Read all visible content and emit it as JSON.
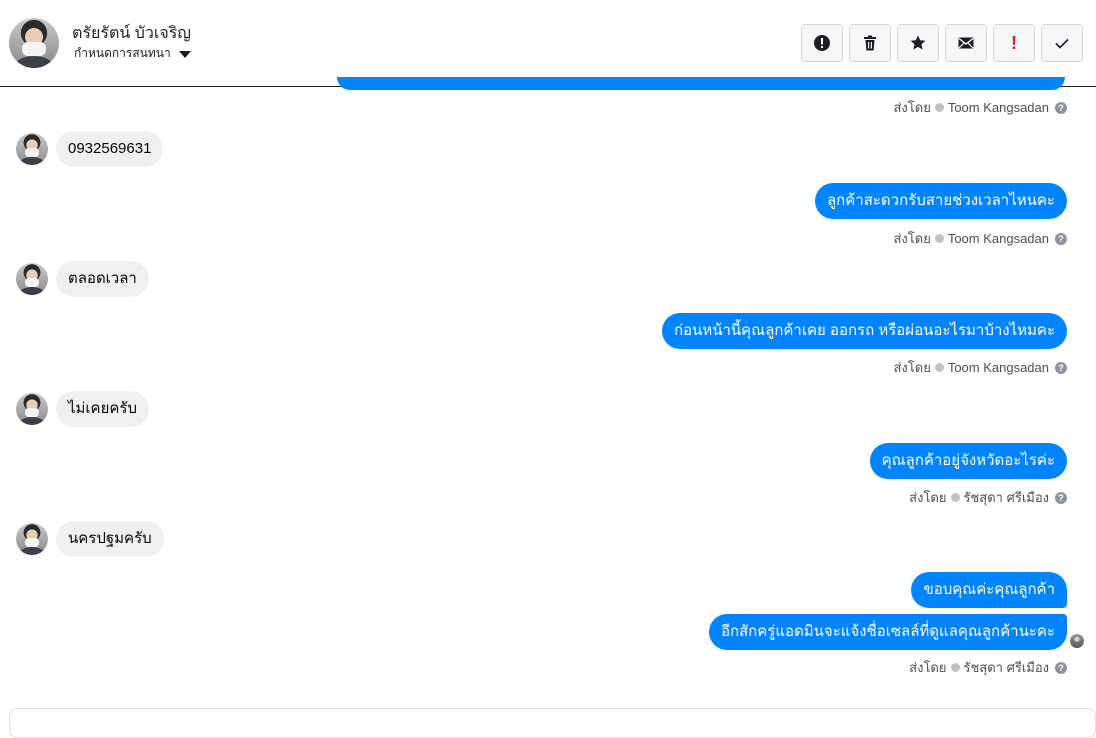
{
  "header": {
    "name": "ตรัยรัตน์ บัวเจริญ",
    "subtitle": "กำหนดการสนทนา",
    "toolbar": [
      {
        "name": "report-spam-button",
        "icon": "exclamation-circle-icon"
      },
      {
        "name": "delete-button",
        "icon": "trash-icon"
      },
      {
        "name": "star-button",
        "icon": "star-icon"
      },
      {
        "name": "mark-unread-button",
        "icon": "envelope-icon"
      },
      {
        "name": "follow-up-button",
        "icon": "exclamation-icon",
        "glyph": "!"
      },
      {
        "name": "mark-done-button",
        "icon": "check-icon"
      }
    ]
  },
  "sender_prefix": "ส่งโดย",
  "messages": {
    "m1": {
      "text": "0932569631"
    },
    "m2": {
      "text": "ลูกค้าสะดวกรับสายช่วงเวลาไหนคะ"
    },
    "m3": {
      "text": "ตลอดเวลา"
    },
    "m4": {
      "text": "ก่อนหน้านี้คุณลูกค้าเคย ออกรถ หรือผ่อนอะไรมาบ้างไหมคะ"
    },
    "m5": {
      "text": "ไม่เคยครับ"
    },
    "m6": {
      "text": "คุณลูกค้าอยู่จังหวัดอะไรค่ะ"
    },
    "m7": {
      "text": "นครปฐมครับ"
    },
    "m8": {
      "text": "ขอบคุณค่ะคุณลูกค้า"
    },
    "m9": {
      "text": "อีกสักครู่แอดมินจะแจ้งชื่อเซลล์ที่ดูแลคุณลูกค้านะคะ"
    }
  },
  "senders": {
    "s0": "Toom Kangsadan",
    "s1": "Toom Kangsadan",
    "s2": "Toom Kangsadan",
    "s3": "รัชสุดา ศรีเมือง",
    "s4": "รัชสุดา ศรีเมือง"
  },
  "help_glyph": "?"
}
